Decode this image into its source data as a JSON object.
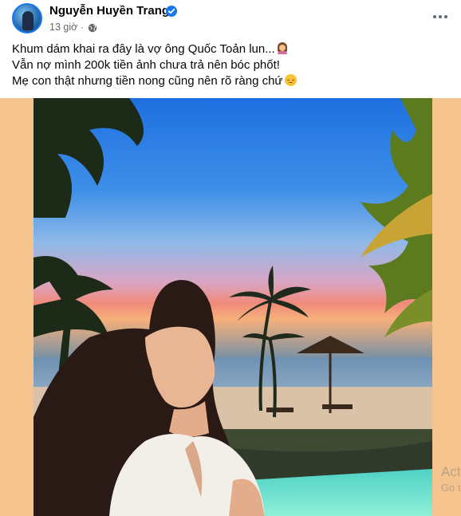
{
  "post": {
    "author": "Nguyễn Huyền Trang",
    "verified": true,
    "time": "13 giờ",
    "visibility_icon": "globe-icon",
    "more_icon": "more-options-icon",
    "caption_lines": [
      "Khum dám khai ra đây là vợ ông Quốc Toản lun...",
      "Vẫn nợ mình 200k tiền ảnh chưa trả nên bóc phốt!",
      "Mẹ con thật nhưng tiền nong cũng nên rõ ràng chứ"
    ],
    "caption_emojis": [
      "person-shrugging-emoji",
      "smirking-face-emoji"
    ],
    "photo": {
      "alt_icon": "beach-sunset-photo",
      "frame_color": "#f5c48e"
    }
  },
  "watermark": {
    "line1": "Act",
    "line2": "Go t"
  },
  "colors": {
    "accent": "#1877f2",
    "text": "#050505",
    "secondary_text": "#65676b"
  }
}
